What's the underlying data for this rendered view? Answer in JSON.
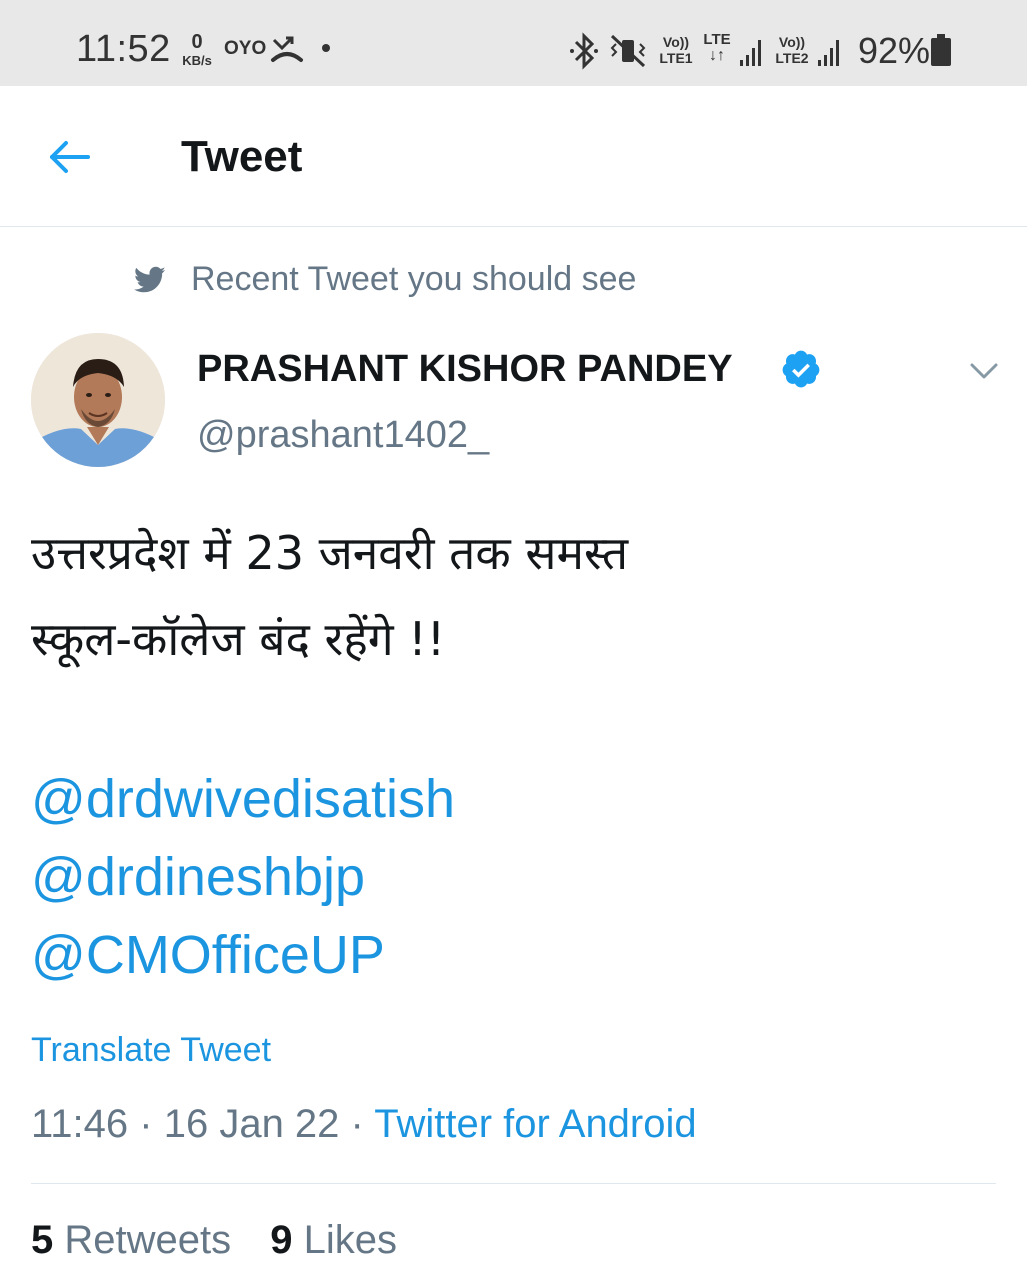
{
  "status_bar": {
    "time": "11:52",
    "network_speed_value": "0",
    "network_speed_unit": "KB/s",
    "app_badge": "OYO",
    "sim1_volte": "Vo))",
    "sim1_label": "LTE1",
    "sim1_lte": "LTE",
    "sim2_volte": "Vo))",
    "sim2_label": "LTE2",
    "battery_percent": "92%"
  },
  "header": {
    "title": "Tweet"
  },
  "tweet": {
    "context_label": "Recent Tweet you should see",
    "author_name": "PRASHANT KISHOR PANDEY",
    "author_handle": "@prashant1402_",
    "body_line1": "उत्तरप्रदेश  में 23 जनवरी तक समस्त",
    "body_line2": "स्कूल-कॉलेज बंद रहेंगे !!",
    "mentions": [
      "@drdwivedisatish",
      "@drdineshbjp",
      "@CMOfficeUP"
    ],
    "translate_label": "Translate Tweet",
    "time": "11:46",
    "separator": "·",
    "date": "16 Jan 22",
    "source": "Twitter for Android",
    "retweets_count": "5",
    "retweets_label": "Retweets",
    "likes_count": "9",
    "likes_label": "Likes"
  },
  "colors": {
    "link_blue": "#1b95e0",
    "muted_gray": "#657786",
    "verified_blue": "#1da1f2",
    "status_bar_bg": "#e8e8e8"
  },
  "icons": {
    "back": "arrow-left-icon",
    "context": "twitter-bird-icon",
    "verified": "verified-badge-icon",
    "caret": "chevron-down-icon",
    "bluetooth": "bluetooth-icon",
    "mute": "vibrate-mute-icon",
    "signal": "signal-icon",
    "battery": "battery-icon",
    "missed_call": "missed-call-icon"
  }
}
